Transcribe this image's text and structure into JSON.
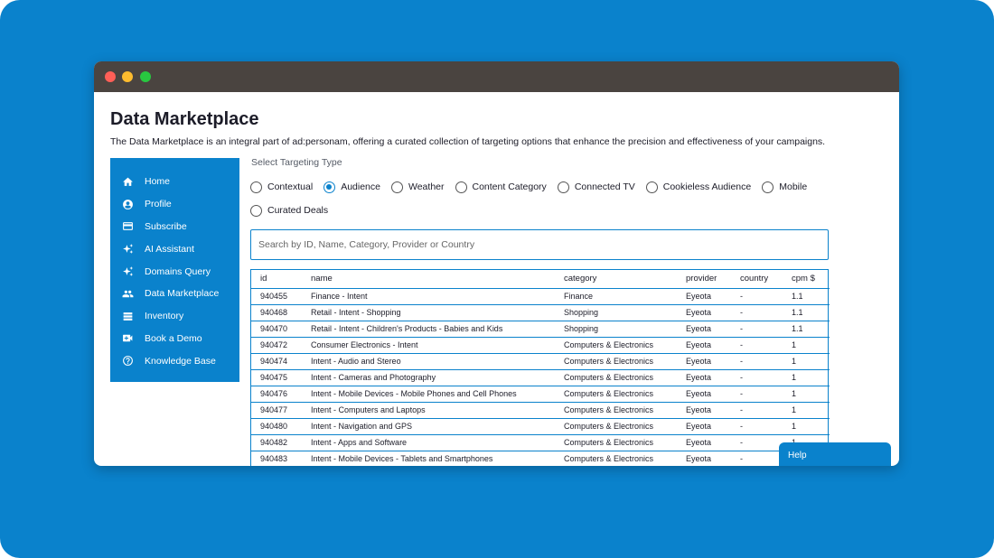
{
  "page": {
    "title": "Data Marketplace",
    "description": "The Data Marketplace is an integral part of ad:personam, offering a curated collection of targeting options that enhance the precision and effectiveness of your campaigns."
  },
  "colors": {
    "accent": "#0a82cc",
    "titlebar": "#4a4440",
    "text": "#1c1c28"
  },
  "sidebar": {
    "items": [
      {
        "label": "Home",
        "icon": "home-icon"
      },
      {
        "label": "Profile",
        "icon": "profile-icon"
      },
      {
        "label": "Subscribe",
        "icon": "credit-card-icon"
      },
      {
        "label": "AI Assistant",
        "icon": "sparkle-icon"
      },
      {
        "label": "Domains Query",
        "icon": "sparkle-icon"
      },
      {
        "label": "Data Marketplace",
        "icon": "people-icon"
      },
      {
        "label": "Inventory",
        "icon": "list-icon"
      },
      {
        "label": "Book a Demo",
        "icon": "video-icon"
      },
      {
        "label": "Knowledge Base",
        "icon": "help-circle-icon"
      }
    ]
  },
  "targeting": {
    "label": "Select Targeting Type",
    "options": [
      "Contextual",
      "Audience",
      "Weather",
      "Content Category",
      "Connected TV",
      "Cookieless Audience",
      "Mobile",
      "Curated Deals"
    ],
    "selected": "Audience"
  },
  "search": {
    "placeholder": "Search by ID, Name, Category, Provider or Country"
  },
  "table": {
    "columns": [
      "id",
      "name",
      "category",
      "provider",
      "country",
      "cpm $"
    ],
    "rows": [
      [
        "940455",
        "Finance - Intent",
        "Finance",
        "Eyeota",
        "-",
        "1.1"
      ],
      [
        "940468",
        "Retail - Intent - Shopping",
        "Shopping",
        "Eyeota",
        "-",
        "1.1"
      ],
      [
        "940470",
        "Retail - Intent - Children's Products - Babies and Kids",
        "Shopping",
        "Eyeota",
        "-",
        "1.1"
      ],
      [
        "940472",
        "Consumer Electronics - Intent",
        "Computers & Electronics",
        "Eyeota",
        "-",
        "1"
      ],
      [
        "940474",
        "Intent - Audio and Stereo",
        "Computers & Electronics",
        "Eyeota",
        "-",
        "1"
      ],
      [
        "940475",
        "Intent - Cameras and Photography",
        "Computers & Electronics",
        "Eyeota",
        "-",
        "1"
      ],
      [
        "940476",
        "Intent - Mobile Devices - Mobile Phones and Cell Phones",
        "Computers & Electronics",
        "Eyeota",
        "-",
        "1"
      ],
      [
        "940477",
        "Intent - Computers and Laptops",
        "Computers & Electronics",
        "Eyeota",
        "-",
        "1"
      ],
      [
        "940480",
        "Intent - Navigation and GPS",
        "Computers & Electronics",
        "Eyeota",
        "-",
        "1"
      ],
      [
        "940482",
        "Intent - Apps and Software",
        "Computers & Electronics",
        "Eyeota",
        "-",
        "1"
      ],
      [
        "940483",
        "Intent - Mobile Devices - Tablets and Smartphones",
        "Computers & Electronics",
        "Eyeota",
        "-",
        ""
      ]
    ]
  },
  "help": {
    "label": "Help"
  }
}
